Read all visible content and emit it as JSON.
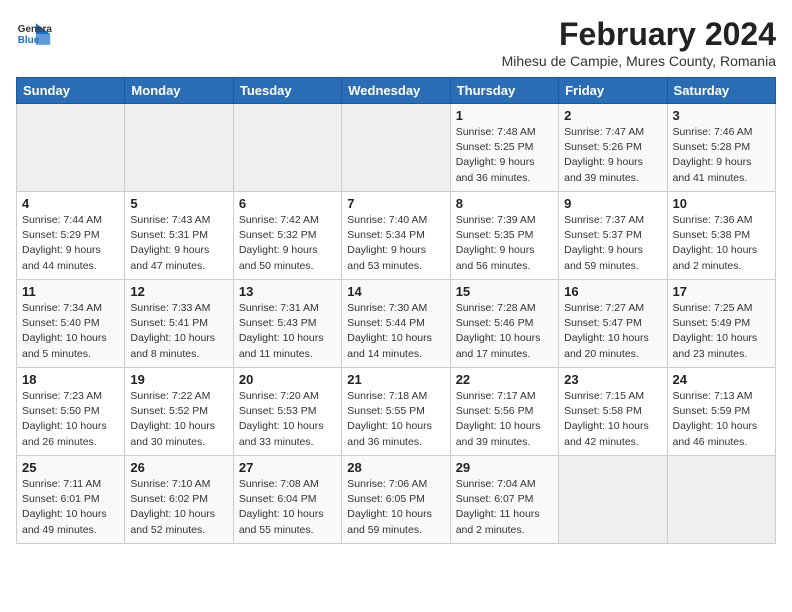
{
  "header": {
    "logo_general": "General",
    "logo_blue": "Blue",
    "month_title": "February 2024",
    "subtitle": "Mihesu de Campie, Mures County, Romania"
  },
  "weekdays": [
    "Sunday",
    "Monday",
    "Tuesday",
    "Wednesday",
    "Thursday",
    "Friday",
    "Saturday"
  ],
  "weeks": [
    [
      {
        "day": "",
        "empty": true
      },
      {
        "day": "",
        "empty": true
      },
      {
        "day": "",
        "empty": true
      },
      {
        "day": "",
        "empty": true
      },
      {
        "day": "1",
        "sunrise": "7:48 AM",
        "sunset": "5:25 PM",
        "daylight": "9 hours and 36 minutes."
      },
      {
        "day": "2",
        "sunrise": "7:47 AM",
        "sunset": "5:26 PM",
        "daylight": "9 hours and 39 minutes."
      },
      {
        "day": "3",
        "sunrise": "7:46 AM",
        "sunset": "5:28 PM",
        "daylight": "9 hours and 41 minutes."
      }
    ],
    [
      {
        "day": "4",
        "sunrise": "7:44 AM",
        "sunset": "5:29 PM",
        "daylight": "9 hours and 44 minutes."
      },
      {
        "day": "5",
        "sunrise": "7:43 AM",
        "sunset": "5:31 PM",
        "daylight": "9 hours and 47 minutes."
      },
      {
        "day": "6",
        "sunrise": "7:42 AM",
        "sunset": "5:32 PM",
        "daylight": "9 hours and 50 minutes."
      },
      {
        "day": "7",
        "sunrise": "7:40 AM",
        "sunset": "5:34 PM",
        "daylight": "9 hours and 53 minutes."
      },
      {
        "day": "8",
        "sunrise": "7:39 AM",
        "sunset": "5:35 PM",
        "daylight": "9 hours and 56 minutes."
      },
      {
        "day": "9",
        "sunrise": "7:37 AM",
        "sunset": "5:37 PM",
        "daylight": "9 hours and 59 minutes."
      },
      {
        "day": "10",
        "sunrise": "7:36 AM",
        "sunset": "5:38 PM",
        "daylight": "10 hours and 2 minutes."
      }
    ],
    [
      {
        "day": "11",
        "sunrise": "7:34 AM",
        "sunset": "5:40 PM",
        "daylight": "10 hours and 5 minutes."
      },
      {
        "day": "12",
        "sunrise": "7:33 AM",
        "sunset": "5:41 PM",
        "daylight": "10 hours and 8 minutes."
      },
      {
        "day": "13",
        "sunrise": "7:31 AM",
        "sunset": "5:43 PM",
        "daylight": "10 hours and 11 minutes."
      },
      {
        "day": "14",
        "sunrise": "7:30 AM",
        "sunset": "5:44 PM",
        "daylight": "10 hours and 14 minutes."
      },
      {
        "day": "15",
        "sunrise": "7:28 AM",
        "sunset": "5:46 PM",
        "daylight": "10 hours and 17 minutes."
      },
      {
        "day": "16",
        "sunrise": "7:27 AM",
        "sunset": "5:47 PM",
        "daylight": "10 hours and 20 minutes."
      },
      {
        "day": "17",
        "sunrise": "7:25 AM",
        "sunset": "5:49 PM",
        "daylight": "10 hours and 23 minutes."
      }
    ],
    [
      {
        "day": "18",
        "sunrise": "7:23 AM",
        "sunset": "5:50 PM",
        "daylight": "10 hours and 26 minutes."
      },
      {
        "day": "19",
        "sunrise": "7:22 AM",
        "sunset": "5:52 PM",
        "daylight": "10 hours and 30 minutes."
      },
      {
        "day": "20",
        "sunrise": "7:20 AM",
        "sunset": "5:53 PM",
        "daylight": "10 hours and 33 minutes."
      },
      {
        "day": "21",
        "sunrise": "7:18 AM",
        "sunset": "5:55 PM",
        "daylight": "10 hours and 36 minutes."
      },
      {
        "day": "22",
        "sunrise": "7:17 AM",
        "sunset": "5:56 PM",
        "daylight": "10 hours and 39 minutes."
      },
      {
        "day": "23",
        "sunrise": "7:15 AM",
        "sunset": "5:58 PM",
        "daylight": "10 hours and 42 minutes."
      },
      {
        "day": "24",
        "sunrise": "7:13 AM",
        "sunset": "5:59 PM",
        "daylight": "10 hours and 46 minutes."
      }
    ],
    [
      {
        "day": "25",
        "sunrise": "7:11 AM",
        "sunset": "6:01 PM",
        "daylight": "10 hours and 49 minutes."
      },
      {
        "day": "26",
        "sunrise": "7:10 AM",
        "sunset": "6:02 PM",
        "daylight": "10 hours and 52 minutes."
      },
      {
        "day": "27",
        "sunrise": "7:08 AM",
        "sunset": "6:04 PM",
        "daylight": "10 hours and 55 minutes."
      },
      {
        "day": "28",
        "sunrise": "7:06 AM",
        "sunset": "6:05 PM",
        "daylight": "10 hours and 59 minutes."
      },
      {
        "day": "29",
        "sunrise": "7:04 AM",
        "sunset": "6:07 PM",
        "daylight": "11 hours and 2 minutes."
      },
      {
        "day": "",
        "empty": true
      },
      {
        "day": "",
        "empty": true
      }
    ]
  ],
  "labels": {
    "sunrise_prefix": "Sunrise: ",
    "sunset_prefix": "Sunset: ",
    "daylight_prefix": "Daylight: "
  }
}
